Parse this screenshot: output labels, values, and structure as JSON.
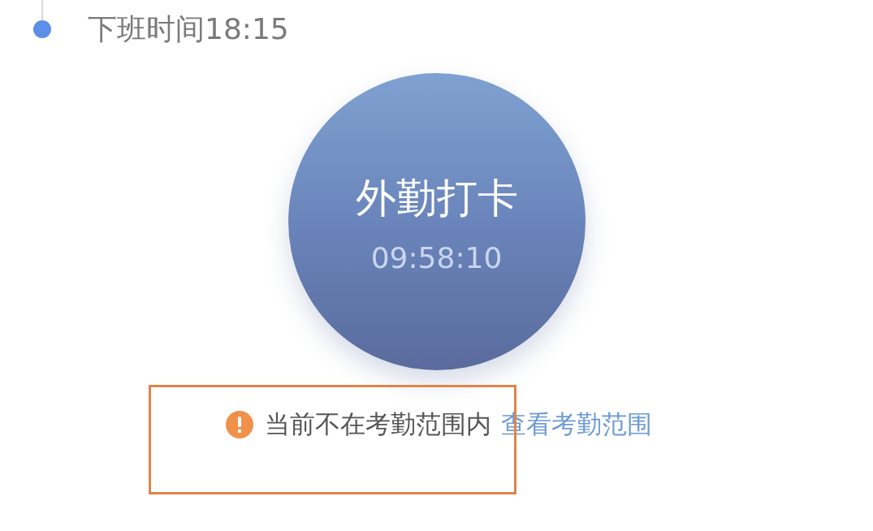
{
  "schedule": {
    "label": "下班时间18:15"
  },
  "clock_button": {
    "title": "外勤打卡",
    "time": "09:58:10"
  },
  "notice": {
    "text": "当前不在考勤范围内",
    "link": "查看考勤范围"
  },
  "annotation": {
    "highlighted": true
  }
}
